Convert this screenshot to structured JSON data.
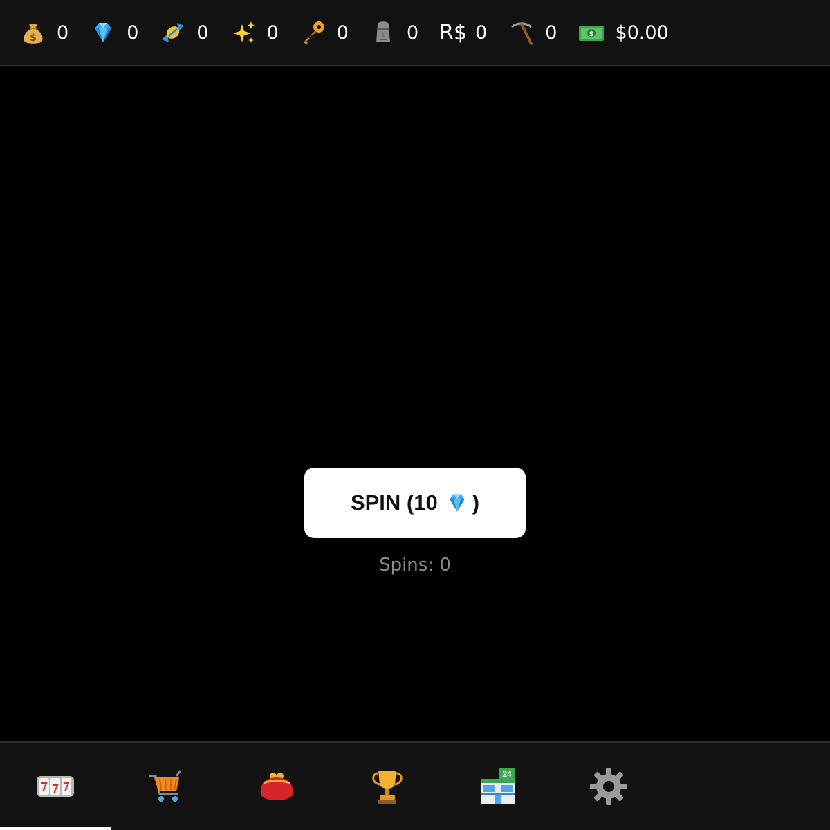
{
  "resources": [
    {
      "icon": "money-bag-icon",
      "value": "0"
    },
    {
      "icon": "gem-icon",
      "value": "0"
    },
    {
      "icon": "candy-icon",
      "value": "0"
    },
    {
      "icon": "sparkles-icon",
      "value": "0"
    },
    {
      "icon": "key-icon",
      "value": "0"
    },
    {
      "icon": "moai-icon",
      "value": "0"
    },
    {
      "icon": "robux-label",
      "label": "R$",
      "value": "0"
    },
    {
      "icon": "pickaxe-icon",
      "value": "0"
    },
    {
      "icon": "dollar-bill-icon",
      "value": "$0.00"
    }
  ],
  "spin": {
    "label": "SPIN (10",
    "close": ")",
    "cost_icon": "gem-icon",
    "spins_text": "Spins: 0"
  },
  "nav": {
    "active": "slot-machine",
    "items": [
      {
        "icon": "slot-machine-icon"
      },
      {
        "icon": "shopping-cart-icon"
      },
      {
        "icon": "purse-icon"
      },
      {
        "icon": "trophy-icon"
      },
      {
        "icon": "convenience-store-icon",
        "badge": "24"
      },
      {
        "icon": "gear-icon"
      }
    ]
  },
  "colors": {
    "background": "#000000",
    "bar": "#121212",
    "button": "#ffffff",
    "muted_text": "#8a8a8a"
  }
}
